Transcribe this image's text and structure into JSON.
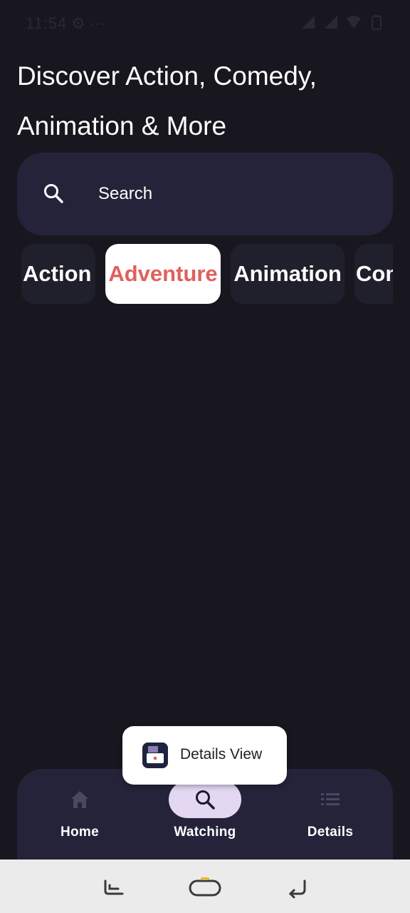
{
  "status_bar": {
    "time": "11:54",
    "extra": "⚙ ···",
    "icons": [
      "signal-icon",
      "signal-icon",
      "wifi-icon",
      "battery-icon"
    ]
  },
  "headline": "Discover Action, Comedy, Animation & More",
  "search": {
    "placeholder": "Search",
    "icon": "search-icon"
  },
  "genres": {
    "items": [
      {
        "label": "Action",
        "selected": false
      },
      {
        "label": "Adventure",
        "selected": true
      },
      {
        "label": "Animation",
        "selected": false
      },
      {
        "label": "Comedy",
        "selected": false
      }
    ]
  },
  "toast": {
    "text": "Details View",
    "icon": "app-icon"
  },
  "bottom_nav": {
    "items": [
      {
        "label": "Home",
        "icon": "home-icon",
        "active": false
      },
      {
        "label": "Watching",
        "icon": "search-icon",
        "active": true
      },
      {
        "label": "Details",
        "icon": "list-icon",
        "active": false
      }
    ]
  },
  "system_nav": {
    "buttons": [
      "recents-icon",
      "home-icon",
      "back-icon"
    ]
  },
  "colors": {
    "background": "#18171f",
    "surface": "#25233a",
    "chip": "#201f2c",
    "accent_text": "#e0605b",
    "active_pill": "#e3d7f2"
  }
}
